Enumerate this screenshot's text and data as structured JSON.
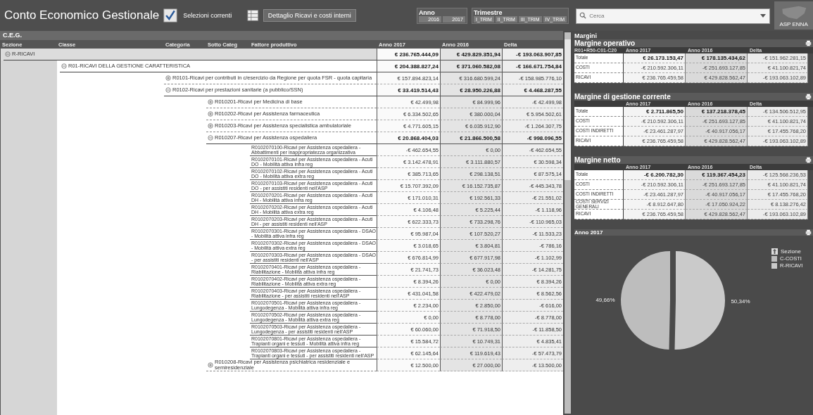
{
  "header": {
    "title": "Conto Economico Gestionale",
    "current_selections": "Selezioni correnti",
    "detail_button": "Dettaglio Ricavi e costi interni",
    "logo_text": "ASP ENNA"
  },
  "year_filter": {
    "label": "Anno",
    "items": [
      "2016",
      "2017"
    ]
  },
  "quarter_filter": {
    "label": "Trimestre",
    "items": [
      "I_TRIM",
      "II_TRIM",
      "III_TRIM",
      "IV_TRIM"
    ]
  },
  "search": {
    "placeholder": "Cerca"
  },
  "pivot": {
    "title": "C.E.G.",
    "columns": [
      "Sezione",
      "Classe",
      "Categoria",
      "Sotto Categ",
      "Fattore produttivo",
      "Anno 2017",
      "Anno 2016",
      "Delta"
    ],
    "tree": [
      {
        "label": "R-RICAVI",
        "expanded": true,
        "values": [
          "€ 236.765.444,09",
          "€ 429.829.351,94",
          "-€ 193.063.907,85"
        ],
        "children": [
          {
            "label": "R01-RICAVI DELLA GESTIONE CARATTERISTICA",
            "expanded": true,
            "values": [
              "€ 204.388.827,24",
              "€ 371.060.582,08",
              "-€ 166.671.754,84"
            ],
            "children": [
              {
                "label": "R0101-Ricavi per contributi in c/esercizio da Regione per quota FSR - quota capitaria",
                "expanded": false,
                "values": [
                  "€ 157.894.823,14",
                  "€ 316.680.599,24",
                  "-€ 158.985.776,10"
                ]
              },
              {
                "label": "R0102-Ricavi per prestazioni sanitarie (a pubblico/SSN)",
                "expanded": true,
                "values": [
                  "€ 33.419.514,43",
                  "€ 28.950.226,88",
                  "€ 4.468.287,55"
                ],
                "children": [
                  {
                    "label": "R010201-Ricavi per Medicina di base",
                    "expanded": false,
                    "values": [
                      "€ 42.499,98",
                      "€ 84.999,96",
                      "-€ 42.499,98"
                    ]
                  },
                  {
                    "label": "R010202-Ricavi per Assistenza farmaceutica",
                    "expanded": false,
                    "values": [
                      "€ 6.334.502,65",
                      "€ 380.000,04",
                      "€ 5.954.502,61"
                    ]
                  },
                  {
                    "label": "R010203-Ricavi per Assistenza specialistica ambulatoriale",
                    "expanded": false,
                    "values": [
                      "€ 4.771.605,15",
                      "€ 6.035.912,90",
                      "-€ 1.264.307,75"
                    ]
                  },
                  {
                    "label": "R010207-Ricavi per Assistenza ospedaliera",
                    "expanded": true,
                    "values": [
                      "€ 20.868.404,03",
                      "€ 21.866.500,58",
                      "-€ 998.096,55"
                    ],
                    "children": [
                      {
                        "label": "R0102070100-Ricavi per Assistenza ospedaliera - Abbattimenti per inappropriatezza organizzativa",
                        "values": [
                          "-€ 462.654,55",
                          "€ 0,00",
                          "-€ 462.654,55"
                        ]
                      },
                      {
                        "label": "R0102070101-Ricavi per Assistenza ospedaliera - Acuti DO - Mobilità attiva infra reg",
                        "values": [
                          "€ 3.142.478,91",
                          "€ 3.111.880,57",
                          "€ 30.598,34"
                        ]
                      },
                      {
                        "label": "R0102070102-Ricavi per Assistenza ospedaliera - Acuti DO - Mobilità attiva extra reg",
                        "values": [
                          "€ 385.713,65",
                          "€ 298.138,51",
                          "€ 87.575,14"
                        ]
                      },
                      {
                        "label": "R0102070103-Ricavi per Assistenza ospedaliera - Acuti DO - per assistiti residenti nell'ASP",
                        "values": [
                          "€ 15.707.392,09",
                          "€ 16.152.735,87",
                          "-€ 445.343,78"
                        ]
                      },
                      {
                        "label": "R0102070201-Ricavi per Assistenza ospedaliera - Acuti DH - Mobilità attiva infra reg",
                        "values": [
                          "€ 171.010,31",
                          "€ 192.561,33",
                          "-€ 21.551,02"
                        ]
                      },
                      {
                        "label": "R0102070202-Ricavi per Assistenza ospedaliera - Acuti DH - Mobilità attiva extra reg",
                        "values": [
                          "€ 4.106,48",
                          "€ 5.225,44",
                          "-€ 1.118,96"
                        ]
                      },
                      {
                        "label": "R0102070203-Ricavi per Assistenza ospedaliera - Acuti DH - per assistiti residenti nell'ASP",
                        "values": [
                          "€ 622.333,73",
                          "€ 733.298,76",
                          "-€ 110.965,03"
                        ]
                      },
                      {
                        "label": "R0102070301-Ricavi per Assistenza ospedaliera - DSAO - Mobilità attiva infra reg",
                        "values": [
                          "€ 95.987,04",
                          "€ 107.520,27",
                          "-€ 11.533,23"
                        ]
                      },
                      {
                        "label": "R0102070302-Ricavi per Assistenza ospedaliera - DSAO - Mobilità attiva extra reg",
                        "values": [
                          "€ 3.018,65",
                          "€ 3.804,81",
                          "-€ 786,16"
                        ]
                      },
                      {
                        "label": "R0102070303-Ricavi per Assistenza ospedaliera - DSAO - per assistiti residenti nell'ASP",
                        "values": [
                          "€ 676.814,99",
                          "€ 677.917,98",
                          "-€ 1.102,99"
                        ]
                      },
                      {
                        "label": "R0102070401-Ricavi per Assistenza ospedaliera - Riabilitazione - Mobilità attiva infra reg",
                        "values": [
                          "€ 21.741,73",
                          "€ 36.023,48",
                          "-€ 14.281,75"
                        ]
                      },
                      {
                        "label": "R0102070402-Ricavi per Assistenza ospedaliera - Riabilitazione - Mobilità attiva extra reg",
                        "values": [
                          "€ 8.394,26",
                          "€ 0,00",
                          "€ 8.394,26"
                        ]
                      },
                      {
                        "label": "R0102070403-Ricavi per Assistenza ospedaliera - Riabilitazione - per assistiti residenti nell'ASP",
                        "values": [
                          "€ 431.041,58",
                          "€ 422.479,02",
                          "€ 8.562,56"
                        ]
                      },
                      {
                        "label": "R0102070501-Ricavi per Assistenza ospedaliera - Lungodegenza - Mobilità attiva infra reg",
                        "values": [
                          "€ 2.234,00",
                          "€ 2.850,00",
                          "-€ 616,00"
                        ]
                      },
                      {
                        "label": "R0102070502-Ricavi per Assistenza ospedaliera - Lungodegenza - Mobilità attiva extra reg",
                        "values": [
                          "€ 0,00",
                          "€ 8.778,00",
                          "-€ 8.778,00"
                        ]
                      },
                      {
                        "label": "R0102070503-Ricavi per Assistenza ospedaliera - Lungodegenza - per assistiti residenti nell'ASP",
                        "values": [
                          "€ 60.060,00",
                          "€ 71.918,50",
                          "-€ 11.858,50"
                        ]
                      },
                      {
                        "label": "R0102070801-Ricavi per Assistenza ospedaliera - Trapianti organi e tessuti - Mobilità attiva infra reg",
                        "values": [
                          "€ 15.584,72",
                          "€ 10.749,31",
                          "€ 4.835,41"
                        ]
                      },
                      {
                        "label": "R0102070803-Ricavi per Assistenza ospedaliera - Trapianti organi e tessuti - per assistiti residenti nell'ASP",
                        "values": [
                          "€ 62.145,64",
                          "€ 119.619,43",
                          "-€ 57.473,79"
                        ]
                      }
                    ]
                  },
                  {
                    "label": "R010208-Ricavi per Assistenza psichiatrica residenziale e semiresidenziale",
                    "expanded": false,
                    "values": [
                      "€ 12.500,00",
                      "€ 27.000,00",
                      "-€ 13.500,00"
                    ]
                  }
                ]
              }
            ]
          }
        ]
      }
    ]
  },
  "margins": {
    "title": "Margini",
    "sections": [
      {
        "title": "Margine operativo",
        "key_header": "R01+R50-C01-C20",
        "columns": [
          "Anno 2017",
          "Anno 2016",
          "Delta"
        ],
        "rows": [
          {
            "kind": "total",
            "label": "Totale",
            "values": [
              "€ 26.173.153,47",
              "€ 178.135.434,62",
              "-€ 151.962.281,15"
            ]
          },
          {
            "kind": "line",
            "label": "COSTI",
            "values": [
              "-€ 210.592.306,11",
              "-€ 251.693.127,85",
              "€ 41.100.821,74"
            ]
          },
          {
            "kind": "line",
            "label": "RICAVI",
            "values": [
              "€ 236.765.459,58",
              "€ 429.828.562,47",
              "-€ 193.063.102,89"
            ]
          }
        ]
      },
      {
        "title": "Margine di gestione corrente",
        "columns": [
          "Anno 2017",
          "Anno 2016",
          "Delta"
        ],
        "rows": [
          {
            "kind": "total",
            "label": "Totale",
            "values": [
              "€ 2.711.865,50",
              "€ 137.218.378,45",
              "-€ 134.506.512,95"
            ]
          },
          {
            "kind": "line",
            "label": "COSTI",
            "values": [
              "-€ 210.592.306,11",
              "-€ 251.693.127,85",
              "€ 41.100.821,74"
            ]
          },
          {
            "kind": "line",
            "label": "COSTI INDIRETTI",
            "values": [
              "-€ 23.461.287,97",
              "-€ 40.917.056,17",
              "€ 17.455.768,20"
            ]
          },
          {
            "kind": "line",
            "label": "RICAVI",
            "values": [
              "€ 236.765.459,58",
              "€ 429.828.562,47",
              "-€ 193.063.102,89"
            ]
          }
        ]
      },
      {
        "title": "Margine netto",
        "columns": [
          "Anno 2017",
          "Anno 2016",
          "Delta"
        ],
        "rows": [
          {
            "kind": "total",
            "label": "Totale",
            "values": [
              "-€ 6.200.782,30",
              "€ 119.367.454,23",
              "-€ 125.568.236,53"
            ]
          },
          {
            "kind": "line",
            "label": "COSTI",
            "values": [
              "-€ 210.592.306,11",
              "-€ 251.693.127,85",
              "€ 41.100.821,74"
            ]
          },
          {
            "kind": "line",
            "label": "COSTI INDIRETTI",
            "values": [
              "-€ 23.461.287,97",
              "-€ 40.917.056,17",
              "€ 17.455.768,20"
            ]
          },
          {
            "kind": "line",
            "label": "COSTI SERVIZI GENERALI",
            "values": [
              "-€ 8.912.647,80",
              "-€ 17.050.924,22",
              "€ 8.138.276,42"
            ]
          },
          {
            "kind": "line",
            "label": "RICAVI",
            "values": [
              "€ 236.765.459,58",
              "€ 429.828.562,47",
              "-€ 193.063.102,89"
            ]
          }
        ]
      }
    ]
  },
  "pie": {
    "chart_data": {
      "type": "pie",
      "title": "Anno 2017",
      "categories": [
        "C-COSTI",
        "R-RICAVI"
      ],
      "series": [
        {
          "name": "Sezione",
          "values": [
            49.66,
            50.34
          ]
        }
      ],
      "value_labels": [
        "49,66%",
        "50,34%"
      ]
    }
  }
}
